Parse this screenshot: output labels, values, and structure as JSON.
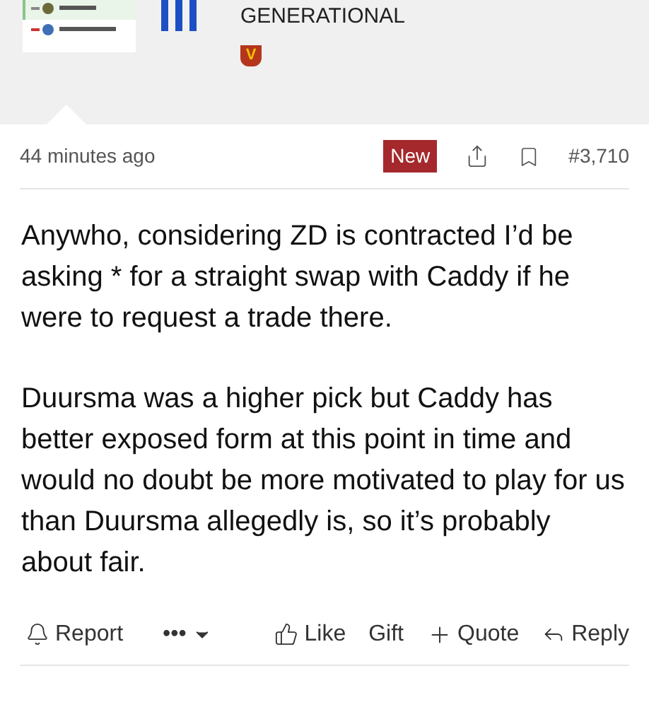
{
  "author": {
    "title": "GENERATIONAL",
    "badge": "V"
  },
  "post": {
    "time": "44 minutes ago",
    "new_label": "New",
    "number": "#3,710",
    "bookmarked": false,
    "paragraphs": [
      "Anywho, considering ZD is contracted I’d be asking * for a straight swap with Caddy if he were to request a trade there.",
      "Duursma was a higher pick but Caddy has better exposed form at this point in time and would no doubt be more motivated to play for us than Duursma allegedly is, so it’s probably about fair."
    ]
  },
  "actions_left": [
    {
      "kind": "report",
      "label": "Report"
    },
    {
      "kind": "more",
      "label": "•••"
    }
  ],
  "actions_right": [
    {
      "kind": "like",
      "label": "Like"
    },
    {
      "kind": "gift",
      "label": "Gift"
    },
    {
      "kind": "quote",
      "label": "Quote"
    },
    {
      "kind": "reply",
      "label": "Reply"
    }
  ]
}
